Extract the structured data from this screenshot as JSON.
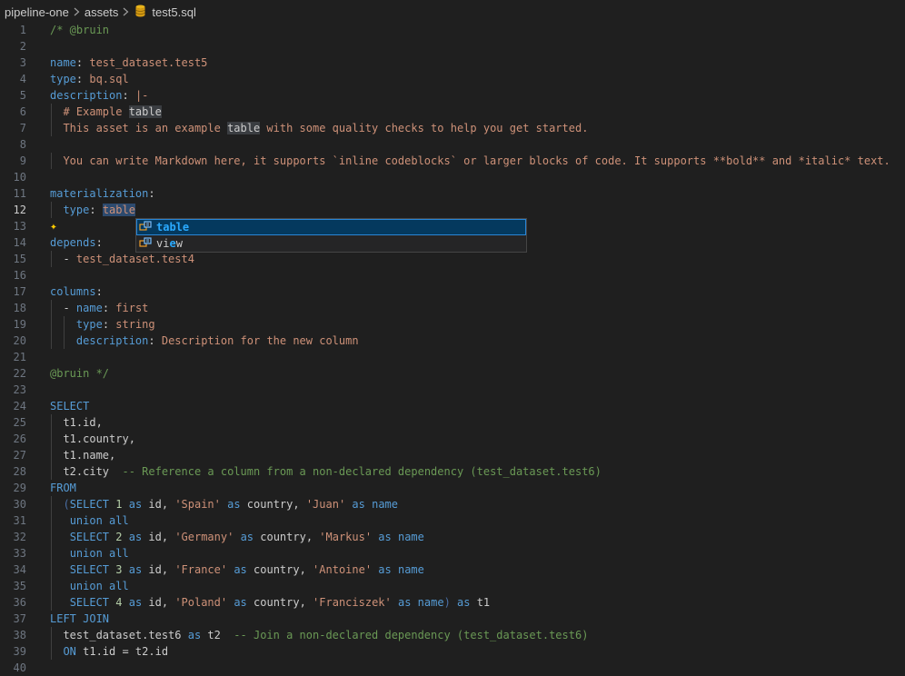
{
  "breadcrumb": {
    "items": [
      "pipeline-one",
      "assets",
      "test5.sql"
    ]
  },
  "colors": {
    "keyword": "#569cd6",
    "string": "#ce9178",
    "comment": "#6a9955",
    "background": "#1f1f1f",
    "selection": "#04395e"
  },
  "editor": {
    "active_line": 12,
    "line_numbers": [
      "1",
      "2",
      "3",
      "4",
      "5",
      "6",
      "7",
      "8",
      "9",
      "10",
      "11",
      "12",
      "13",
      "14",
      "15",
      "16",
      "17",
      "18",
      "19",
      "20",
      "21",
      "22",
      "23",
      "24",
      "25",
      "26",
      "27",
      "28",
      "29",
      "30",
      "31",
      "32",
      "33",
      "34",
      "35",
      "36",
      "37",
      "38",
      "39",
      "40"
    ],
    "lines": [
      [
        [
          "c",
          "/* @bruin"
        ]
      ],
      [],
      [
        [
          "k",
          "name"
        ],
        [
          "p",
          ": "
        ],
        [
          "s",
          "test_dataset.test5"
        ]
      ],
      [
        [
          "k",
          "type"
        ],
        [
          "p",
          ": "
        ],
        [
          "s",
          "bq.sql"
        ]
      ],
      [
        [
          "k",
          "description"
        ],
        [
          "p",
          ": "
        ],
        [
          "s",
          "|-"
        ]
      ],
      [
        [
          "p",
          "  "
        ],
        [
          "s",
          "# Example "
        ],
        [
          "hl",
          "table"
        ]
      ],
      [
        [
          "p",
          "  "
        ],
        [
          "s",
          "This asset is an example "
        ],
        [
          "hl",
          "table"
        ],
        [
          "s",
          " with some quality checks to help you get started."
        ]
      ],
      [],
      [
        [
          "p",
          "  "
        ],
        [
          "s",
          "You can write Markdown here, it supports `inline codeblocks` or larger blocks of code. It supports **bold** and *italic* text."
        ]
      ],
      [],
      [
        [
          "k",
          "materialization"
        ],
        [
          "p",
          ":"
        ]
      ],
      [
        [
          "p",
          "  "
        ],
        [
          "k",
          "type"
        ],
        [
          "p",
          ": "
        ],
        [
          "hl2",
          "table"
        ]
      ],
      [],
      [
        [
          "k",
          "depends"
        ],
        [
          "p",
          ":"
        ]
      ],
      [
        [
          "p",
          "  - "
        ],
        [
          "s",
          "test_dataset.test4"
        ]
      ],
      [],
      [
        [
          "k",
          "columns"
        ],
        [
          "p",
          ":"
        ]
      ],
      [
        [
          "p",
          "  - "
        ],
        [
          "k",
          "name"
        ],
        [
          "p",
          ": "
        ],
        [
          "s",
          "first"
        ]
      ],
      [
        [
          "p",
          "    "
        ],
        [
          "k",
          "type"
        ],
        [
          "p",
          ": "
        ],
        [
          "s",
          "string"
        ]
      ],
      [
        [
          "p",
          "    "
        ],
        [
          "k",
          "description"
        ],
        [
          "p",
          ": "
        ],
        [
          "s",
          "Description for the new column"
        ]
      ],
      [],
      [
        [
          "c",
          "@bruin */"
        ]
      ],
      [],
      [
        [
          "k",
          "SELECT"
        ]
      ],
      [
        [
          "p",
          "  t1.id,"
        ]
      ],
      [
        [
          "p",
          "  t1.country,"
        ]
      ],
      [
        [
          "p",
          "  t1.name,"
        ]
      ],
      [
        [
          "p",
          "  t2.city  "
        ],
        [
          "c",
          "-- Reference a column from a non-declared dependency (test_dataset.test6)"
        ]
      ],
      [
        [
          "k",
          "FROM"
        ]
      ],
      [
        [
          "p",
          "  "
        ],
        [
          "par",
          "("
        ],
        [
          "k",
          "SELECT "
        ],
        [
          "n",
          "1"
        ],
        [
          "k",
          " as "
        ],
        [
          "p",
          "id, "
        ],
        [
          "s",
          "'Spain'"
        ],
        [
          "k",
          " as "
        ],
        [
          "p",
          "country, "
        ],
        [
          "s",
          "'Juan'"
        ],
        [
          "k",
          " as "
        ],
        [
          "k",
          "name"
        ]
      ],
      [
        [
          "p",
          "   "
        ],
        [
          "k",
          "union all"
        ]
      ],
      [
        [
          "p",
          "   "
        ],
        [
          "k",
          "SELECT "
        ],
        [
          "n",
          "2"
        ],
        [
          "k",
          " as "
        ],
        [
          "p",
          "id, "
        ],
        [
          "s",
          "'Germany'"
        ],
        [
          "k",
          " as "
        ],
        [
          "p",
          "country, "
        ],
        [
          "s",
          "'Markus'"
        ],
        [
          "k",
          " as "
        ],
        [
          "k",
          "name"
        ]
      ],
      [
        [
          "p",
          "   "
        ],
        [
          "k",
          "union all"
        ]
      ],
      [
        [
          "p",
          "   "
        ],
        [
          "k",
          "SELECT "
        ],
        [
          "n",
          "3"
        ],
        [
          "k",
          " as "
        ],
        [
          "p",
          "id, "
        ],
        [
          "s",
          "'France'"
        ],
        [
          "k",
          " as "
        ],
        [
          "p",
          "country, "
        ],
        [
          "s",
          "'Antoine'"
        ],
        [
          "k",
          " as "
        ],
        [
          "k",
          "name"
        ]
      ],
      [
        [
          "p",
          "   "
        ],
        [
          "k",
          "union all"
        ]
      ],
      [
        [
          "p",
          "   "
        ],
        [
          "k",
          "SELECT "
        ],
        [
          "n",
          "4"
        ],
        [
          "k",
          " as "
        ],
        [
          "p",
          "id, "
        ],
        [
          "s",
          "'Poland'"
        ],
        [
          "k",
          " as "
        ],
        [
          "p",
          "country, "
        ],
        [
          "s",
          "'Franciszek'"
        ],
        [
          "k",
          " as "
        ],
        [
          "k",
          "name"
        ],
        [
          "par",
          ")"
        ],
        [
          "k",
          " as "
        ],
        [
          "p",
          "t1"
        ]
      ],
      [
        [
          "k",
          "LEFT JOIN"
        ]
      ],
      [
        [
          "p",
          "  test_dataset.test6 "
        ],
        [
          "k",
          "as"
        ],
        [
          "p",
          " t2  "
        ],
        [
          "c",
          "-- Join a non-declared dependency (test_dataset.test6)"
        ]
      ],
      [
        [
          "p",
          "  "
        ],
        [
          "k",
          "ON"
        ],
        [
          "p",
          " t1.id = t2.id"
        ]
      ],
      []
    ]
  },
  "suggest": {
    "items": [
      {
        "pre": "",
        "match": "table",
        "post": "",
        "icon": "enum-member-icon",
        "selected": true
      },
      {
        "pre": "vi",
        "match": "e",
        "post": "w",
        "icon": "enum-member-icon",
        "selected": false
      }
    ]
  },
  "ai_icon": "sparkle-icon"
}
